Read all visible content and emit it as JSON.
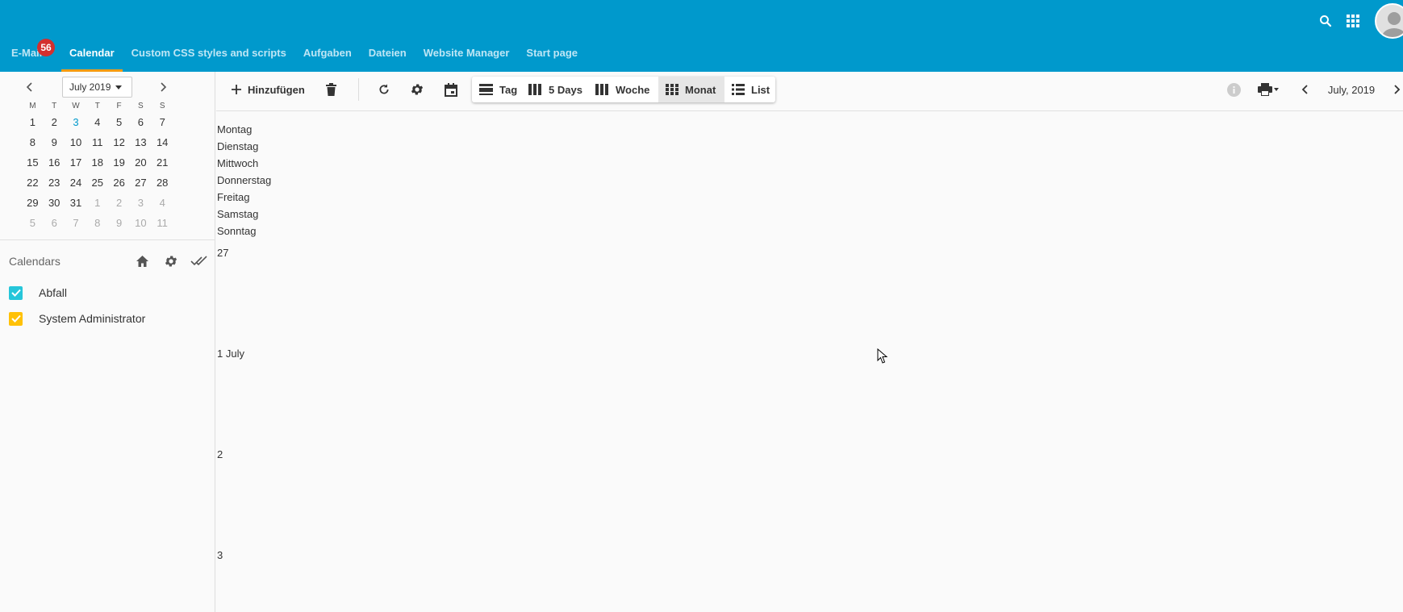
{
  "header": {
    "tabs": [
      {
        "label": "E-Mail"
      },
      {
        "label": "Calendar"
      },
      {
        "label": "Custom CSS styles and scripts"
      },
      {
        "label": "Aufgaben"
      },
      {
        "label": "Dateien"
      },
      {
        "label": "Website Manager"
      },
      {
        "label": "Start page"
      }
    ],
    "active_tab": "Calendar",
    "email_badge": "56",
    "icons": [
      "search-icon",
      "apps-grid-icon",
      "user-avatar"
    ],
    "colors": {
      "bar": "#0099cc",
      "active_underline": "#f39c12",
      "badge": "#d32f2f"
    }
  },
  "mini_calendar": {
    "month_label": "July 2019",
    "weekday_headers": [
      "M",
      "T",
      "W",
      "T",
      "F",
      "S",
      "S"
    ],
    "weeks": [
      [
        "1",
        "2",
        "3",
        "4",
        "5",
        "6",
        "7"
      ],
      [
        "8",
        "9",
        "10",
        "11",
        "12",
        "13",
        "14"
      ],
      [
        "15",
        "16",
        "17",
        "18",
        "19",
        "20",
        "21"
      ],
      [
        "22",
        "23",
        "24",
        "25",
        "26",
        "27",
        "28"
      ],
      [
        "29",
        "30",
        "31",
        "1",
        "2",
        "3",
        "4"
      ],
      [
        "5",
        "6",
        "7",
        "8",
        "9",
        "10",
        "11"
      ]
    ],
    "today": "3",
    "today_color": "#0099cc"
  },
  "calendars": {
    "title": "Calendars",
    "items": [
      {
        "label": "Abfall",
        "color": "#26c6da",
        "checked": true
      },
      {
        "label": "System Administrator",
        "color": "#ffc107",
        "checked": true
      }
    ]
  },
  "toolbar": {
    "add_label": "Hinzufügen",
    "views": [
      {
        "label": "Tag",
        "icon": "day-view-icon"
      },
      {
        "label": "5 Days",
        "icon": "five-days-icon"
      },
      {
        "label": "Woche",
        "icon": "week-view-icon"
      },
      {
        "label": "Monat",
        "icon": "month-view-icon",
        "active": true
      },
      {
        "label": "List",
        "icon": "list-view-icon"
      }
    ],
    "period_label": "July, 2019"
  },
  "main": {
    "day_names": [
      "Montag",
      "Dienstag",
      "Mittwoch",
      "Donnerstag",
      "Freitag",
      "Samstag",
      "Sonntag"
    ],
    "day_numbers": [
      "27",
      "1 July",
      "2",
      "3"
    ]
  }
}
